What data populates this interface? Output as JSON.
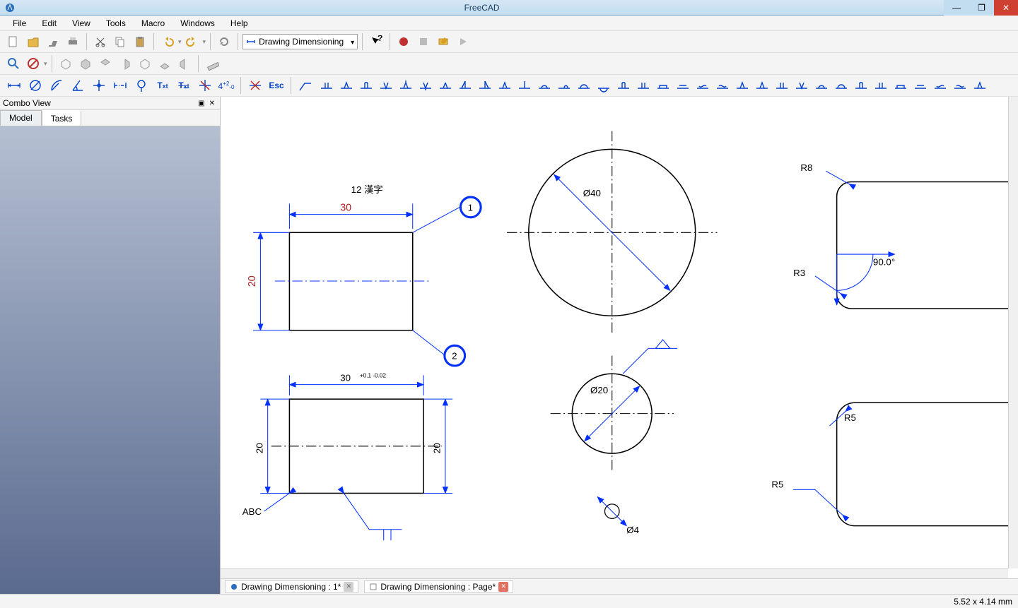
{
  "app": {
    "title": "FreeCAD"
  },
  "menu": {
    "items": [
      "File",
      "Edit",
      "View",
      "Tools",
      "Macro",
      "Windows",
      "Help"
    ]
  },
  "workbench": {
    "label": "Drawing Dimensioning"
  },
  "combo": {
    "header": "Combo View",
    "tabs": {
      "model": "Model",
      "tasks": "Tasks",
      "active": "Tasks"
    }
  },
  "doctabs": {
    "a": "Drawing Dimensioning : 1*",
    "b": "Drawing Dimensioning : Page*"
  },
  "status": {
    "coords": "5.52 x 4.14 mm"
  },
  "drawing": {
    "note_top": "12  漢字",
    "dim_w": "30",
    "dim_h": "20",
    "balloon1": "1",
    "balloon2": "2",
    "dim_w2": "30",
    "tol2": "+0.1\n-0.02",
    "dim_h2a": "20",
    "dim_h2b": "20",
    "label_abc": "ABC",
    "dia_big": "Ø40",
    "dia_mid": "Ø20",
    "dia_small": "Ø4",
    "r8": "R8",
    "r3": "R3",
    "r5a": "R5",
    "r5b": "R5",
    "angle": "90.0°"
  }
}
